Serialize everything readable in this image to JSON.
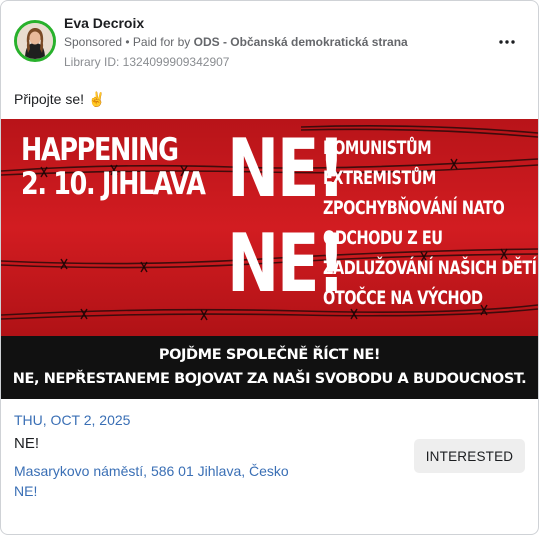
{
  "post": {
    "author": "Eva Decroix",
    "sponsored": "Sponsored",
    "paid_for_prefix": " • Paid for by ",
    "paid_for_by": "ODS - Občanská demokratická strana",
    "library_id": "Library ID: 1324099909342907",
    "text": "Připojte se!",
    "icons": {
      "avatar": "avatar-photo",
      "more": "more-horizontal-icon",
      "emoji": "victory-hand-emoji"
    }
  },
  "banner": {
    "happening_line1": "HAPPENING",
    "happening_line2": "2. 10. JIHLAVA",
    "ne_big_1": "NE!",
    "ne_big_2": "NE!",
    "items": [
      "KOMUNISTŮM",
      "EXTREMISTŮM",
      "ZPOCHYBŇOVÁNÍ NATO",
      "ODCHODU Z EU",
      "ZADLUŽOVÁNÍ NAŠICH DĚTÍ",
      "OTOČCE NA VÝCHOD"
    ],
    "footer_line1": "POJĎME SPOLEČNĚ ŘÍCT NE!",
    "footer_line2": "NE, NEPŘESTANEME BOJOVAT ZA NAŠI SVOBODU A BUDOUCNOST.",
    "colors": {
      "red": "#c9161b",
      "black": "#111111"
    }
  },
  "event": {
    "date": "THU, OCT 2, 2025",
    "title": "NE!",
    "location_line1": "Masarykovo náměstí, 586 01 Jihlava, Česko",
    "location_line2": "NE!",
    "button": "INTERESTED"
  }
}
